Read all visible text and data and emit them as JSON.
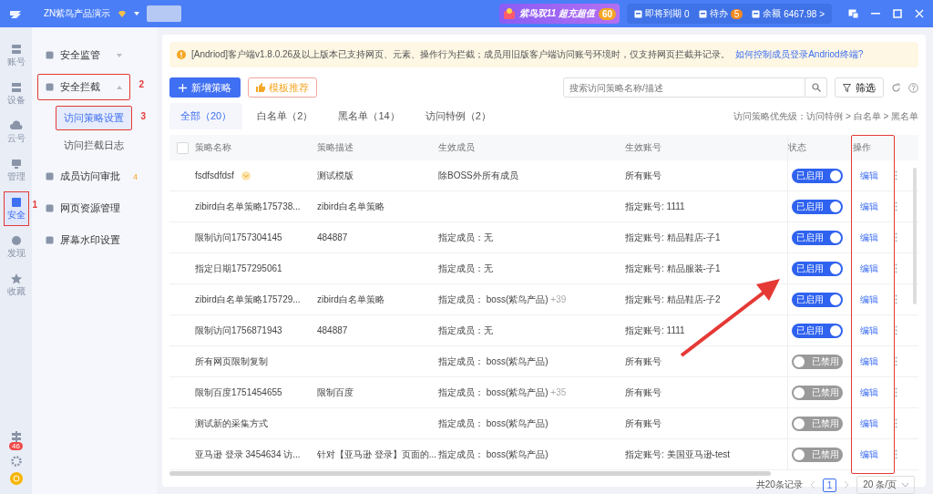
{
  "topbar": {
    "workspace": "ZN紫鸟产品演示",
    "promo": {
      "text": "紫鸟双11 超充超值",
      "badge": "60"
    },
    "stats": [
      {
        "label": "即将到期",
        "value": "0",
        "kind": "plain"
      },
      {
        "label": "待办",
        "value": "5",
        "kind": "badge"
      },
      {
        "label": "余额",
        "value": "6467.98 >",
        "kind": "plain"
      }
    ]
  },
  "rail": {
    "items": [
      {
        "label": "账号",
        "selected": false
      },
      {
        "label": "设备",
        "selected": false
      },
      {
        "label": "云号",
        "selected": false
      },
      {
        "label": "管理",
        "selected": false
      },
      {
        "label": "安全",
        "selected": true,
        "annotation": "1"
      },
      {
        "label": "发现",
        "selected": false
      },
      {
        "label": "收藏",
        "selected": false
      }
    ],
    "notification_count": "46"
  },
  "subnav": {
    "items": [
      {
        "label": "安全监管",
        "expanded": false
      },
      {
        "label": "安全拦截",
        "expanded": true,
        "annotation": "2",
        "children": [
          {
            "label": "访问策略设置",
            "selected": true,
            "annotation": "3"
          },
          {
            "label": "访问拦截日志",
            "selected": false
          }
        ]
      },
      {
        "label": "成员访问审批",
        "badge": "4"
      },
      {
        "label": "网页资源管理"
      },
      {
        "label": "屏幕水印设置"
      }
    ]
  },
  "notice": {
    "text": "[Andriod]客户端v1.8.0.26及以上版本已支持网页、元素、操作行为拦截；成员用旧版客户端访问账号环境时，仅支持网页拦截并记录。",
    "link": "如何控制成员登录Andriod终端?"
  },
  "toolbar": {
    "add_button": "新增策略",
    "template_button": "模板推荐",
    "search": {
      "placeholder": "搜索访问策略名称/描述"
    },
    "filter_button": "筛选"
  },
  "tabs": [
    {
      "label": "全部（20）",
      "selected": true
    },
    {
      "label": "白名单（2）",
      "selected": false
    },
    {
      "label": "黑名单（14）",
      "selected": false
    },
    {
      "label": "访问特例（2）",
      "selected": false
    }
  ],
  "priority_note": "访问策略优先级：访问特例 > 白名单 > 黑名单",
  "table": {
    "columns": [
      "策略名称",
      "策略描述",
      "生效成员",
      "生效账号",
      "状态",
      "操作"
    ],
    "operations_highlighted": true,
    "all_selected": false,
    "rows": [
      {
        "name": "fsdfsdfdsf",
        "vip": true,
        "description": "测试模版",
        "members": "除BOSS外所有成员",
        "accounts": "所有账号",
        "enabled": true,
        "status_label": "已启用",
        "action": "编辑"
      },
      {
        "name": "zibird白名单策略175738...",
        "description": "zibird白名单策略",
        "members": "",
        "accounts": "指定账号: 1111",
        "enabled": true,
        "status_label": "已启用",
        "action": "编辑"
      },
      {
        "name": "限制访问1757304145",
        "description": "484887",
        "members": "指定成员：无",
        "accounts": "指定账号: 精品鞋店-子1",
        "enabled": true,
        "status_label": "已启用",
        "action": "编辑"
      },
      {
        "name": "指定日期1757295061",
        "description": "",
        "members": "指定成员：无",
        "accounts": "指定账号: 精品服装-子1",
        "enabled": true,
        "status_label": "已启用",
        "action": "编辑"
      },
      {
        "name": "zibird白名单策略175729...",
        "description": "zibird白名单策略",
        "members": "指定成员： boss(紫鸟产品)",
        "more": "+39",
        "accounts": "指定账号: 精品鞋店-子2",
        "enabled": true,
        "status_label": "已启用",
        "action": "编辑"
      },
      {
        "name": "限制访问1756871943",
        "description": "484887",
        "members": "指定成员：无",
        "accounts": "指定账号: 1111",
        "enabled": true,
        "status_label": "已启用",
        "action": "编辑"
      },
      {
        "name": "所有网页限制复制",
        "description": "",
        "members": "指定成员： boss(紫鸟产品)",
        "accounts": "所有账号",
        "enabled": false,
        "status_label": "已禁用",
        "action": "编辑"
      },
      {
        "name": "限制百度1751454655",
        "description": "限制百度",
        "members": "指定成员： boss(紫鸟产品)",
        "more": "+35",
        "accounts": "所有账号",
        "enabled": false,
        "status_label": "已禁用",
        "action": "编辑"
      },
      {
        "name": "测试新的采集方式",
        "description": "",
        "members": "指定成员： boss(紫鸟产品)",
        "accounts": "所有账号",
        "enabled": false,
        "status_label": "已禁用",
        "action": "编辑"
      },
      {
        "name": "亚马逊 登录 3454634 访...",
        "description": "针对【亚马逊 登录】页面的...",
        "members": "指定成员： boss(紫鸟产品)",
        "accounts": "指定账号: 美国亚马逊-test",
        "enabled": false,
        "status_label": "已禁用",
        "action": "编辑"
      }
    ]
  },
  "pagination": {
    "total": "共20条记录",
    "pages": [
      {
        "label": "1",
        "selected": true
      }
    ],
    "page_size": "20 条/页"
  },
  "annotation_arrow": true
}
